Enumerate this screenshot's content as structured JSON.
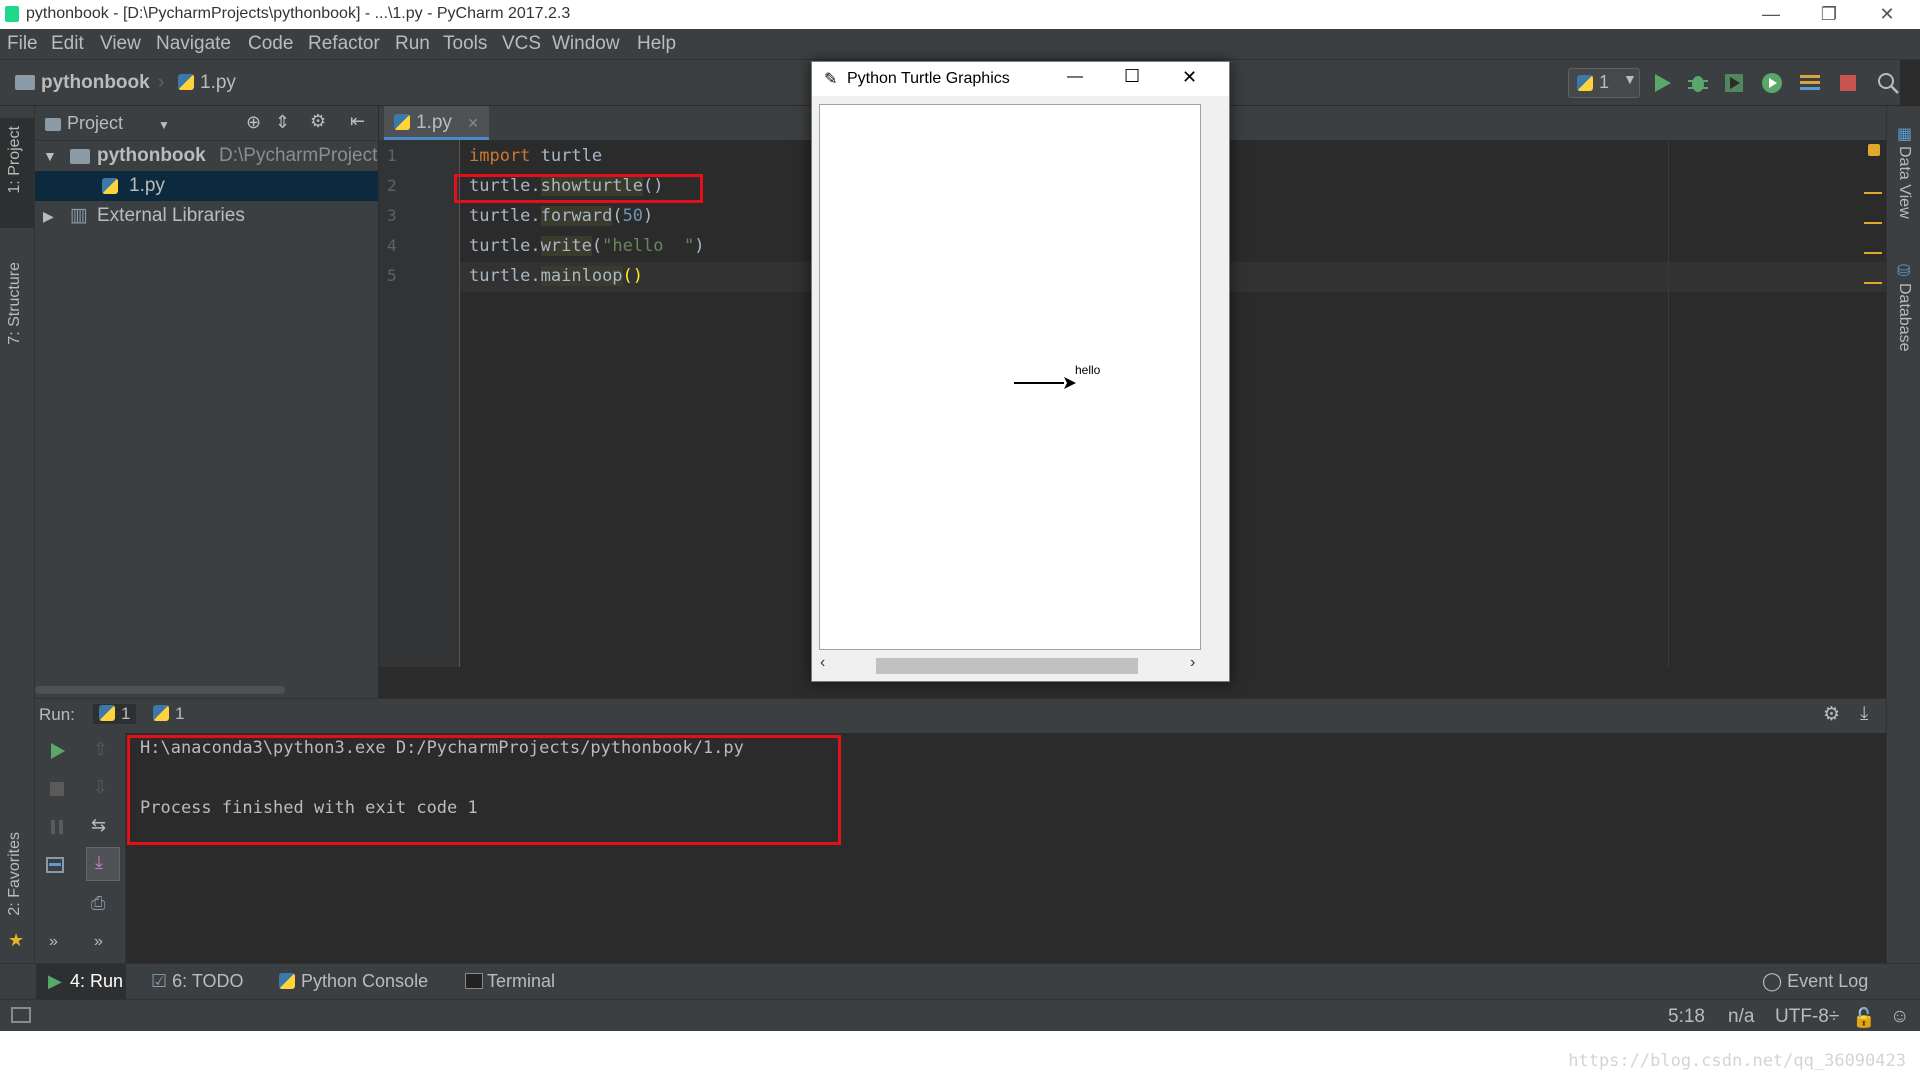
{
  "window": {
    "title": "pythonbook - [D:\\PycharmProjects\\pythonbook] - ...\\1.py - PyCharm 2017.2.3",
    "minimize": "—",
    "restore": "❐",
    "close": "✕"
  },
  "menu": [
    "File",
    "Edit",
    "View",
    "Navigate",
    "Code",
    "Refactor",
    "Run",
    "Tools",
    "VCS",
    "Window",
    "Help"
  ],
  "navbar": {
    "project": "pythonbook",
    "file": "1.py",
    "run_config": "1"
  },
  "left_stripe": {
    "project_tab": "1: Project",
    "structure_tab": "7: Structure",
    "favorites_tab": "2: Favorites"
  },
  "right_stripe": {
    "data_view": "Data View",
    "database": "Database"
  },
  "project_panel": {
    "header": "Project",
    "root_name": "pythonbook",
    "root_path": "D:\\PycharmProject",
    "file": "1.py",
    "external": "External Libraries"
  },
  "editor": {
    "tab_label": "1.py",
    "line_numbers": [
      "1",
      "2",
      "3",
      "4",
      "5"
    ],
    "lines": {
      "l1_kw": "import",
      "l1_rest": " turtle",
      "l2_obj": "turtle.",
      "l2_fn": "showturtle",
      "l2_args": "()",
      "l3_obj": "turtle.",
      "l3_fn": "forward",
      "l3_open": "(",
      "l3_num": "50",
      "l3_close": ")",
      "l4_obj": "turtle.",
      "l4_fn": "write",
      "l4_open": "(",
      "l4_str": "\"hello  \"",
      "l4_close": ")",
      "l5_obj": "turtle.",
      "l5_fn": "mainloop",
      "l5_args": "()"
    }
  },
  "run_panel": {
    "label": "Run:",
    "tab1": "1",
    "tab2": "1",
    "console_line1": "H:\\anaconda3\\python3.exe D:/PycharmProjects/pythonbook/1.py",
    "console_line2": "Process finished with exit code 1"
  },
  "bottom_tabs": {
    "run": "4: Run",
    "todo": "6: TODO",
    "python_console": "Python Console",
    "terminal": "Terminal",
    "event_log": "Event Log"
  },
  "status": {
    "position": "5:18",
    "na": "n/a",
    "encoding": "UTF-8÷"
  },
  "turtle_window": {
    "title": "Python Turtle Graphics",
    "minimize": "—",
    "maximize": "☐",
    "close": "✕",
    "written_text": "hello"
  },
  "watermark": "https://blog.csdn.net/qq_36090423",
  "colors": {
    "accent": "#4a88c7",
    "highlight_box": "#e3101a",
    "keyword": "#cc7832",
    "number": "#6897bb",
    "string": "#6a8759",
    "run_green": "#59a869",
    "stop_red": "#c75450"
  }
}
